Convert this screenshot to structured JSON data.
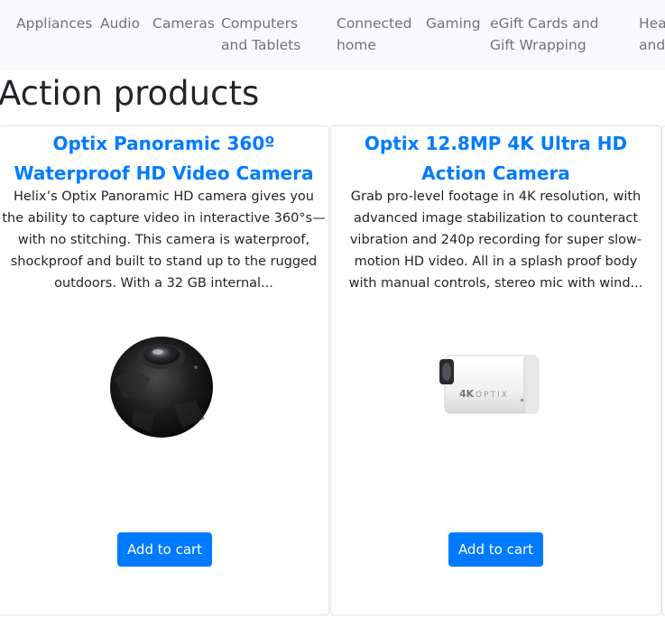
{
  "nav": {
    "items": [
      {
        "label": "Appliances"
      },
      {
        "label": "Audio"
      },
      {
        "label": "Cameras"
      },
      {
        "label": "Computers and Tablets"
      },
      {
        "label": "Connected home"
      },
      {
        "label": "Gaming"
      },
      {
        "label": "eGift Cards and Gift Wrapping"
      },
      {
        "label": "Health and"
      }
    ]
  },
  "page": {
    "title": "Action products"
  },
  "products": [
    {
      "title": "Optix Panoramic 360º Waterproof HD Video Camera",
      "description": "Helix’s Optix Panoramic HD camera gives you the ability to capture video in interactive 360°s— with no stitching. This camera is waterproof, shockproof and built to stand up to the rugged outdoors. With a 32 GB internal...",
      "button_label": "Add to cart",
      "image": "black-spherical-360-camera"
    },
    {
      "title": "Optix 12.8MP 4K Ultra HD Action Camera",
      "description": "Grab pro-level footage in 4K resolution, with advanced image stabilization to counteract vibration and 240p recording for super slow-motion HD video. All in a splash proof body with manual controls, stereo mic with wind...",
      "button_label": "Add to cart",
      "image": "white-4k-action-camera",
      "image_text": "4KOPTIX"
    }
  ]
}
